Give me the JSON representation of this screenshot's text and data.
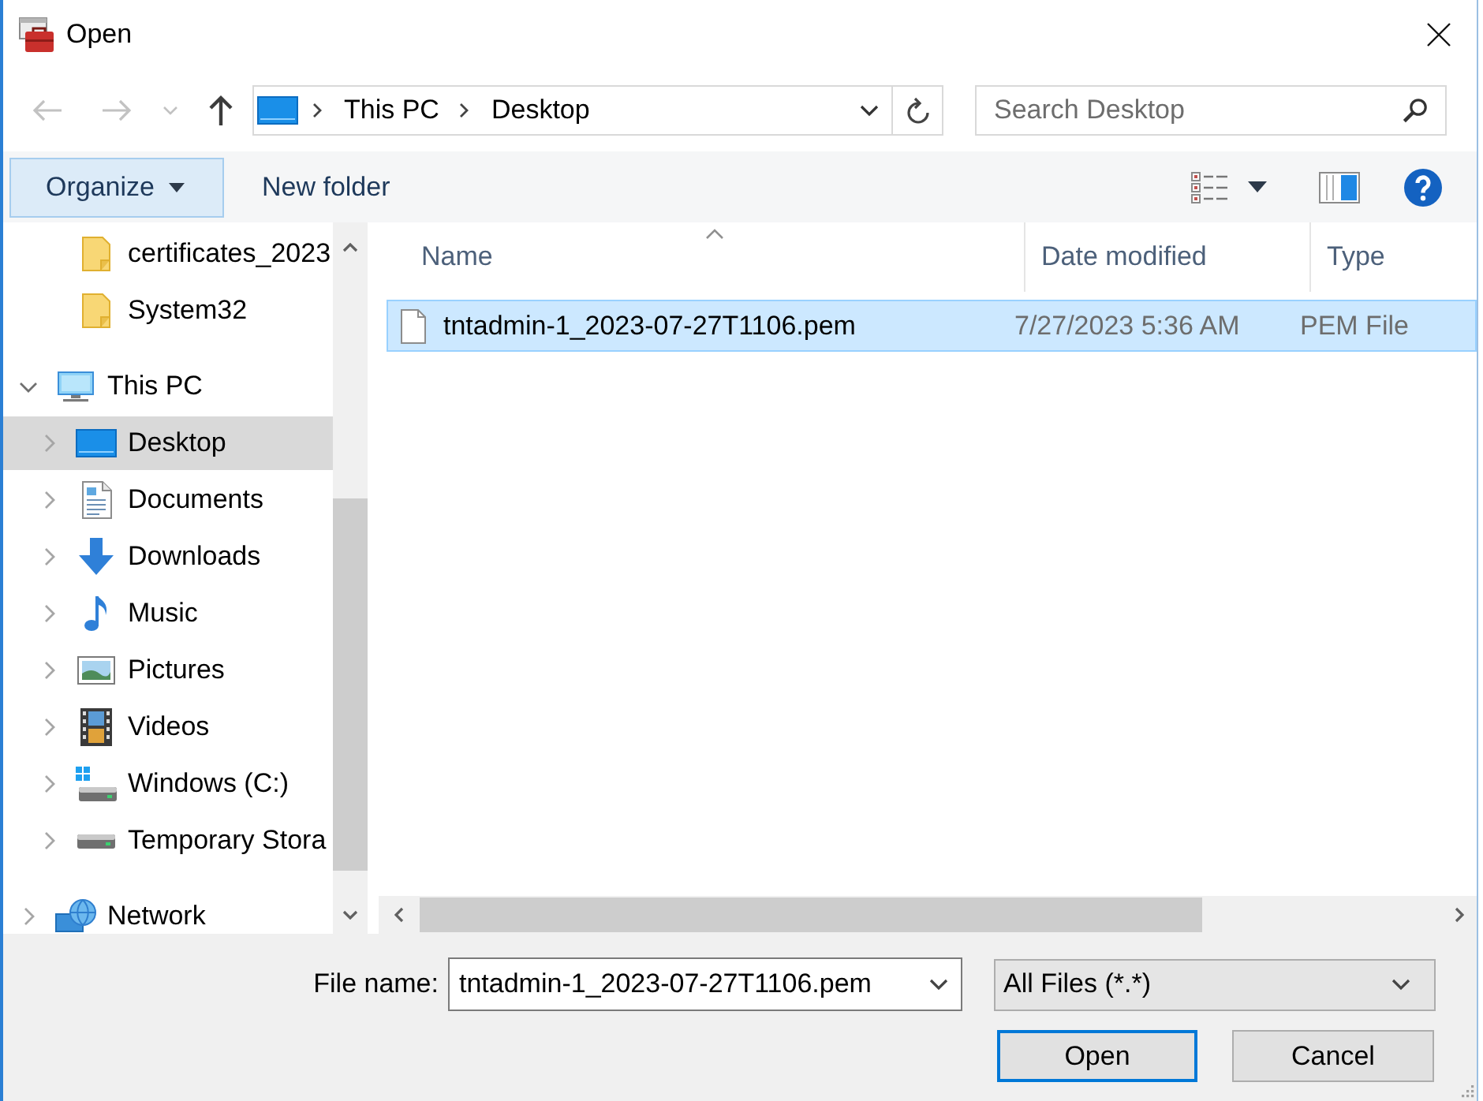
{
  "window": {
    "title": "Open"
  },
  "nav_buttons": [
    {
      "kind": "back",
      "disabled": true
    },
    {
      "kind": "forward",
      "disabled": true
    },
    {
      "kind": "recent",
      "disabled": true
    },
    {
      "kind": "up",
      "disabled": false
    }
  ],
  "address_bar": {
    "path": [
      "This PC",
      "Desktop"
    ]
  },
  "search": {
    "placeholder": "Search Desktop"
  },
  "toolbar": {
    "organize": {
      "label": "Organize",
      "highlighted": true
    },
    "new_folder": "New folder"
  },
  "nav_pane": {
    "tree": [
      {
        "children": [
          {
            "label": "certificates_2023",
            "kind": "folder",
            "selected": false
          },
          {
            "label": "System32",
            "kind": "folder",
            "selected": false
          }
        ]
      },
      {
        "label": "This PC",
        "kind": "pc",
        "expanded": true,
        "selected": false,
        "children": [
          {
            "label": "Desktop",
            "kind": "desktop",
            "expanded": false,
            "selected": true
          },
          {
            "label": "Documents",
            "kind": "documents",
            "expanded": false,
            "selected": false
          },
          {
            "label": "Downloads",
            "kind": "downloads",
            "expanded": false,
            "selected": false
          },
          {
            "label": "Music",
            "kind": "music",
            "expanded": false,
            "selected": false
          },
          {
            "label": "Pictures",
            "kind": "pictures",
            "expanded": false,
            "selected": false
          },
          {
            "label": "Videos",
            "kind": "videos",
            "expanded": false,
            "selected": false
          },
          {
            "label": "Windows (C:)",
            "kind": "system-drive",
            "expanded": false,
            "selected": false
          },
          {
            "label": "Temporary Stora",
            "kind": "drive",
            "expanded": false,
            "selected": false
          }
        ]
      },
      {
        "label": "Network",
        "kind": "network",
        "expanded": false,
        "selected": false
      }
    ]
  },
  "file_list": {
    "columns": [
      {
        "label": "Name",
        "sorted": true
      },
      {
        "label": "Date modified",
        "sorted": false
      },
      {
        "label": "Type",
        "sorted": false
      }
    ],
    "rows": [
      {
        "name": "tntadmin-1_2023-07-27T1106.pem",
        "date_modified": "7/27/2023 5:36 AM",
        "type": "PEM File",
        "selected": true
      }
    ]
  },
  "file_name": {
    "label": "File name:",
    "value": "tntadmin-1_2023-07-27T1106.pem"
  },
  "file_type": {
    "value": "All Files (*.*)"
  },
  "buttons": [
    {
      "label": "Open",
      "default": true
    },
    {
      "label": "Cancel",
      "default": false
    }
  ]
}
